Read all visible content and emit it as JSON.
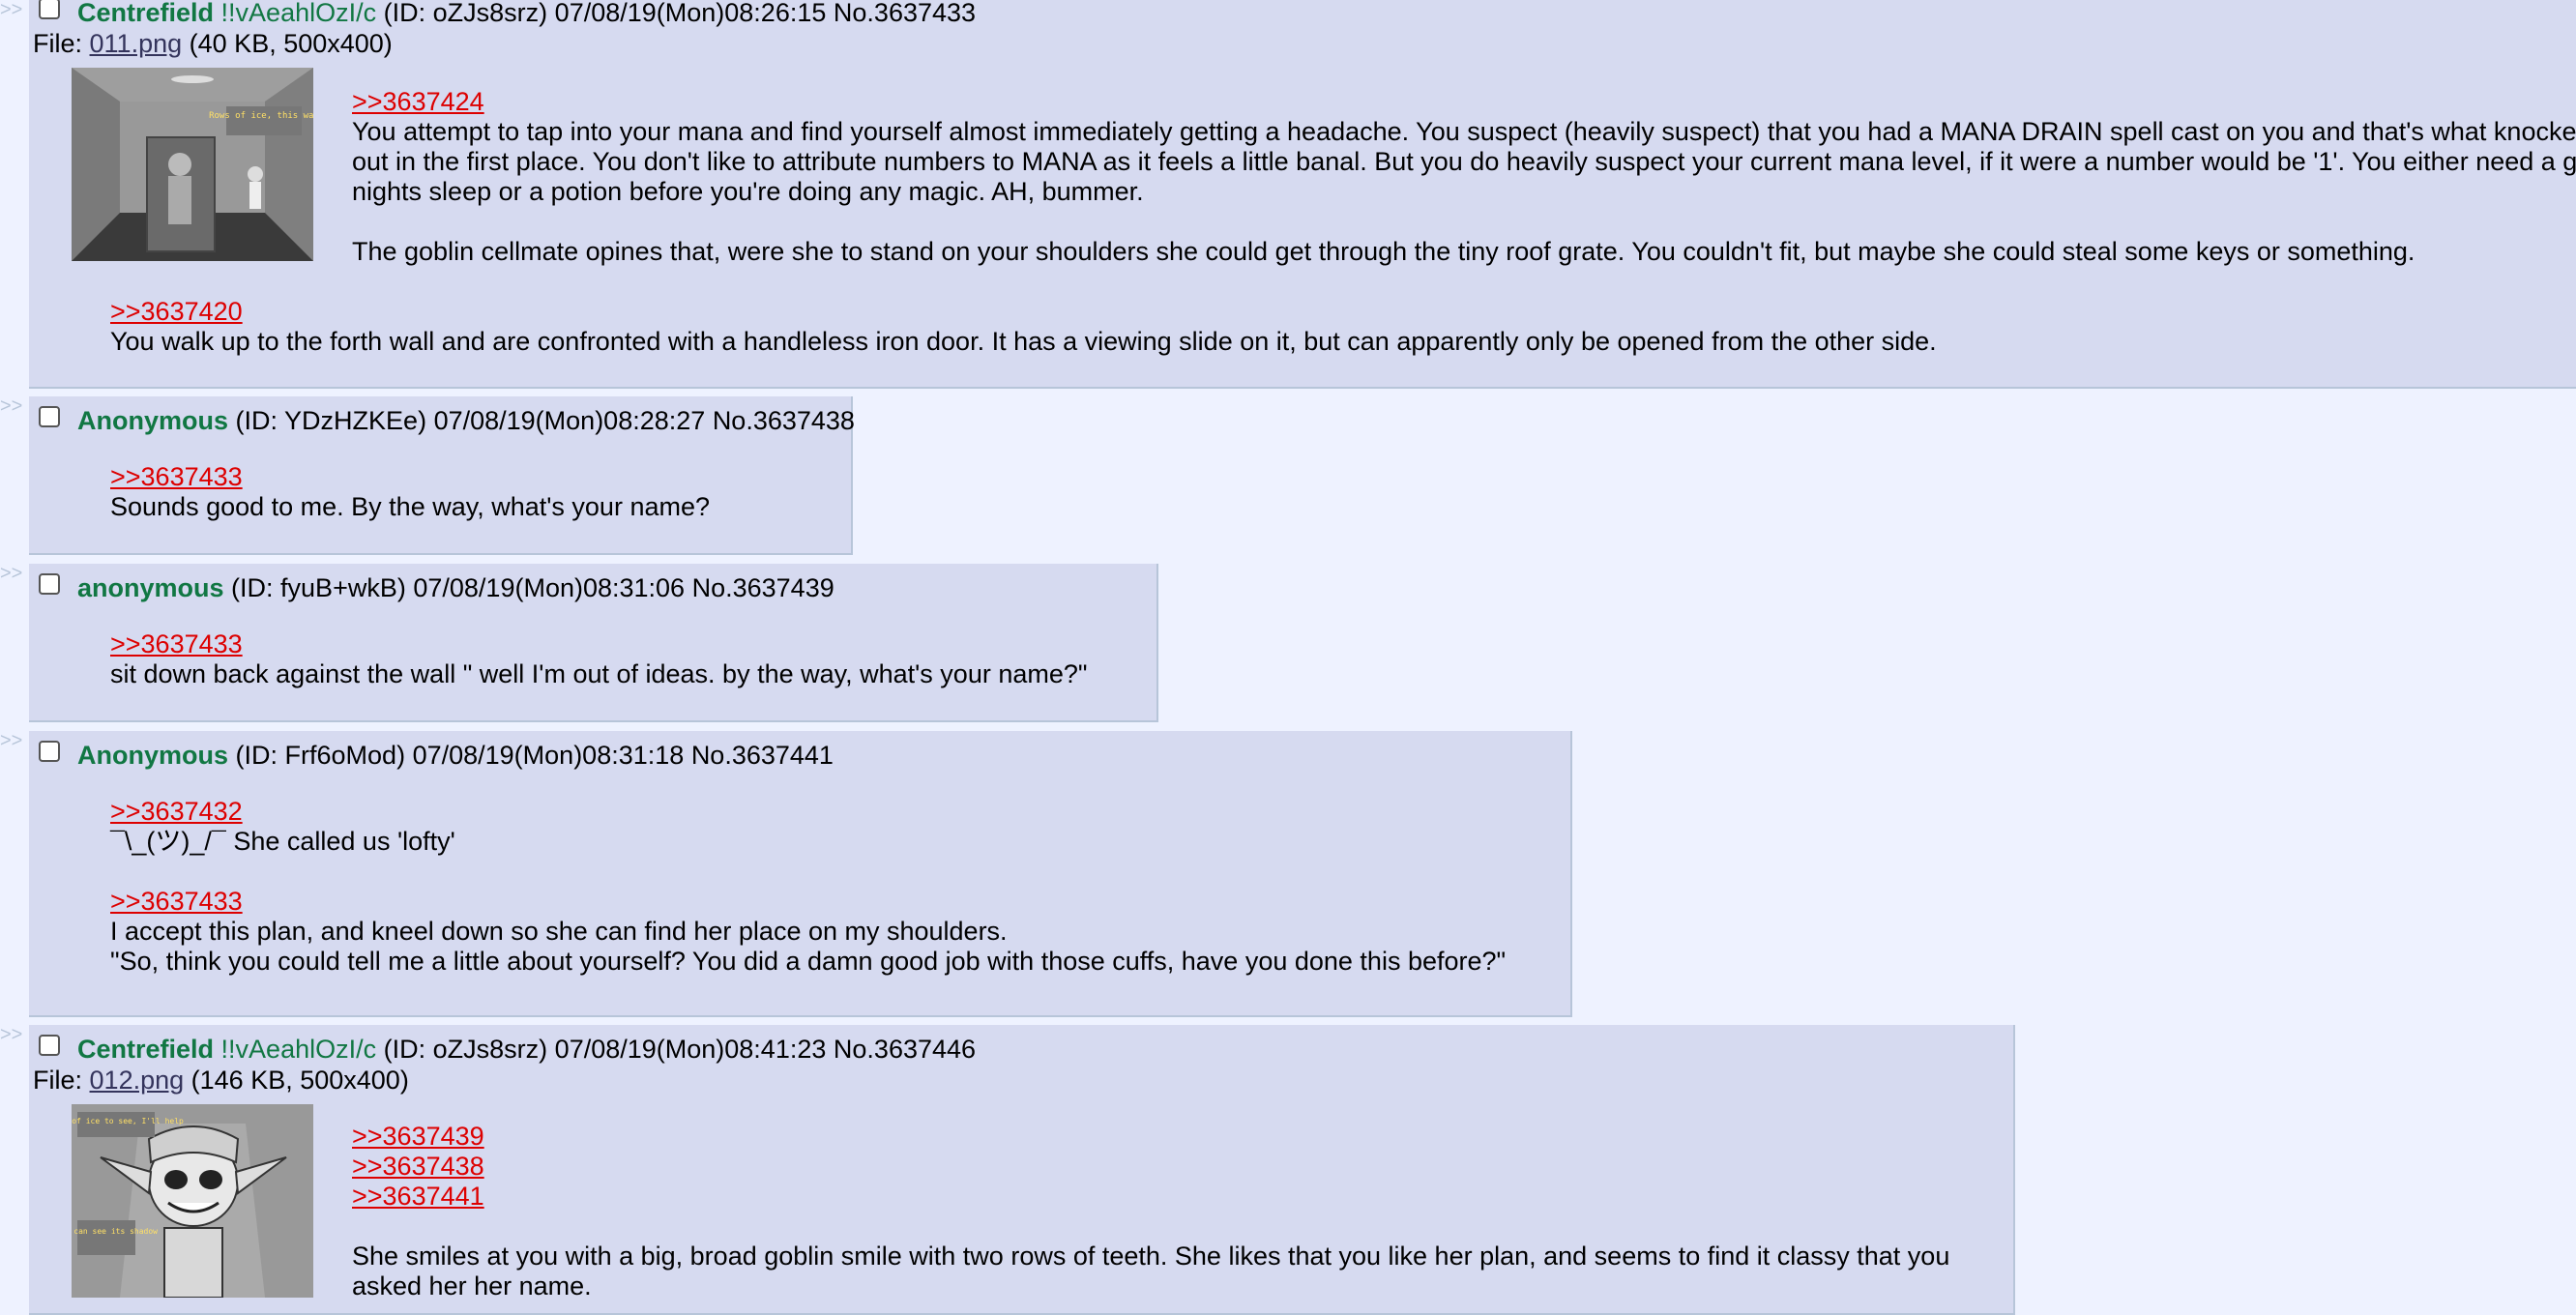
{
  "posts": {
    "p3637433": {
      "name": "Centrefield",
      "tripcode": "!!vAeahlOzI/c",
      "id": "(ID: oZJs8srz)",
      "datetime": "07/08/19(Mon)08:26:15",
      "number": "No.3637433",
      "file": {
        "label": "File:",
        "filename": "011.png",
        "meta": "(40 KB, 500x400)"
      },
      "reply1": {
        "quote": ">>3637424",
        "lines": [
          "You attempt to tap into your mana and find yourself almost immediately getting a headache. You suspect (heavily suspect) that you had a MANA DRAIN spell cast on you and that's what knocked y",
          "out in the first place. You don't like to attribute numbers to MANA as it feels a little banal. But you do heavily suspect your current mana level, if it were a number would be '1'. You either need a goo",
          "nights sleep or a potion before you're doing any magic. AH, bummer.",
          "The goblin cellmate opines that, were she to stand on your shoulders she could get through the tiny roof grate. You couldn't fit, but maybe she could steal some keys or something."
        ]
      },
      "reply2": {
        "quote": ">>3637420",
        "line": "You walk up to the forth wall and are confronted with a handleless iron door. It has a viewing slide on it, but can apparently only be opened from the other side."
      }
    },
    "p3637438": {
      "name": "Anonymous",
      "id": "(ID: YDzHZKEe)",
      "datetime": "07/08/19(Mon)08:28:27",
      "number": "No.3637438",
      "quote": ">>3637433",
      "line": "Sounds good to me. By the way, what's your name?"
    },
    "p3637439": {
      "name": "anonymous",
      "id": "(ID: fyuB+wkB)",
      "datetime": "07/08/19(Mon)08:31:06",
      "number": "No.3637439",
      "quote": ">>3637433",
      "line": "sit down back against the wall \" well I'm out of ideas. by the way, what's your name?\""
    },
    "p3637441": {
      "name": "Anonymous",
      "id": "(ID: Frf6oMod)",
      "datetime": "07/08/19(Mon)08:31:18",
      "number": "No.3637441",
      "quote1": ">>3637432",
      "line1": "¯\\_(ツ)_/¯ She called us 'lofty'",
      "quote2": ">>3637433",
      "line2a": "I accept this plan, and kneel down so she can find her place on my shoulders.",
      "line2b": "\"So, think you could tell me a little about yourself? You did a damn good job with those cuffs, have you done this before?\""
    },
    "p3637446": {
      "name": "Centrefield",
      "tripcode": "!!vAeahlOzI/c",
      "id": "(ID: oZJs8srz)",
      "datetime": "07/08/19(Mon)08:41:23",
      "number": "No.3637446",
      "file": {
        "label": "File:",
        "filename": "012.png",
        "meta": "(146 KB, 500x400)"
      },
      "quotes": [
        ">>3637439",
        ">>3637438",
        ">>3637441"
      ],
      "line1": "She smiles at you with a big, broad goblin smile with two rows of teeth. She likes that you like her plan, and seems to find it classy that you",
      "line2": "asked her her name."
    }
  },
  "side_marker": ">>",
  "thumb1_caption": "Rows of ice, this way",
  "thumb2_caption_top": "Rows of ice to see, I'll help",
  "thumb2_caption_bottom": "You can see its shadow",
  "colors": {
    "background": "#eef2ff",
    "post_bg": "#d6daf0",
    "name": "#117743",
    "quote": "#dd0000",
    "border": "#b7c5d9"
  }
}
